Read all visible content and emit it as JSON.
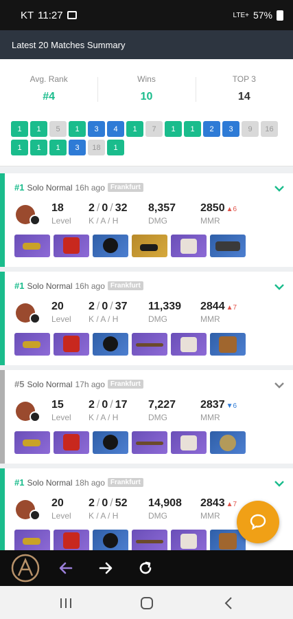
{
  "status_bar": {
    "carrier": "KT",
    "time": "11:27",
    "network": "LTE+",
    "battery": "57%"
  },
  "header": {
    "title": "Latest 20 Matches Summary"
  },
  "summary": {
    "stats": [
      {
        "label": "Avg. Rank",
        "value": "#4",
        "color": "#1abc8c"
      },
      {
        "label": "Wins",
        "value": "10",
        "color": "#1abc8c"
      },
      {
        "label": "TOP 3",
        "value": "14",
        "color": "#333333"
      }
    ],
    "ranks_row1": [
      {
        "v": "1",
        "c": "green"
      },
      {
        "v": "1",
        "c": "green"
      },
      {
        "v": "5",
        "c": "gray"
      },
      {
        "v": "1",
        "c": "green"
      },
      {
        "v": "3",
        "c": "blue"
      },
      {
        "v": "4",
        "c": "blue"
      },
      {
        "v": "1",
        "c": "green"
      },
      {
        "v": "7",
        "c": "gray"
      },
      {
        "v": "1",
        "c": "green"
      },
      {
        "v": "1",
        "c": "green"
      },
      {
        "v": "2",
        "c": "blue"
      },
      {
        "v": "3",
        "c": "blue"
      },
      {
        "v": "9",
        "c": "gray"
      },
      {
        "v": "16",
        "c": "gray"
      }
    ],
    "ranks_row2": [
      {
        "v": "1",
        "c": "green"
      },
      {
        "v": "1",
        "c": "green"
      },
      {
        "v": "1",
        "c": "green"
      },
      {
        "v": "3",
        "c": "blue"
      },
      {
        "v": "18",
        "c": "gray"
      },
      {
        "v": "1",
        "c": "green"
      }
    ]
  },
  "rank_colors": {
    "green": "#1abc8c",
    "blue": "#2e7bd6",
    "gray": "#d9d9d9"
  },
  "stat_labels": {
    "level": "Level",
    "kah": "K / A / H",
    "dmg": "DMG",
    "mmr": "MMR"
  },
  "matches": [
    {
      "place": "#1",
      "mode": "Solo Normal",
      "ago": "16h ago",
      "server": "Frankfurt",
      "level": "18",
      "k": "2",
      "a": "0",
      "h": "32",
      "dmg": "8,357",
      "mmr": "2850",
      "delta_sign": "▲",
      "delta": "6",
      "win": true,
      "chevron": "green",
      "items": [
        "gun-icon",
        "shirt-icon",
        "helmet-icon",
        "glove-icon",
        "boots-icon",
        "tape-icon"
      ]
    },
    {
      "place": "#1",
      "mode": "Solo Normal",
      "ago": "16h ago",
      "server": "Frankfurt",
      "level": "20",
      "k": "2",
      "a": "0",
      "h": "37",
      "dmg": "11,339",
      "mmr": "2844",
      "delta_sign": "▲",
      "delta": "7",
      "win": true,
      "chevron": "green",
      "items": [
        "gun-icon",
        "shirt-icon",
        "helmet-icon",
        "stick-icon",
        "boots-icon",
        "box-icon"
      ]
    },
    {
      "place": "#5",
      "mode": "Solo Normal",
      "ago": "17h ago",
      "server": "Frankfurt",
      "level": "15",
      "k": "2",
      "a": "0",
      "h": "17",
      "dmg": "7,227",
      "mmr": "2837",
      "delta_sign": "▼",
      "delta": "6",
      "win": false,
      "chevron": "gray",
      "items": [
        "gun-icon",
        "shirt-icon",
        "helmet-icon",
        "stick-icon",
        "boots-icon",
        "disc-icon"
      ]
    },
    {
      "place": "#1",
      "mode": "Solo Normal",
      "ago": "18h ago",
      "server": "Frankfurt",
      "level": "20",
      "k": "2",
      "a": "0",
      "h": "52",
      "dmg": "14,908",
      "mmr": "2843",
      "delta_sign": "▲",
      "delta": "7",
      "win": true,
      "chevron": "green",
      "items": [
        "gun-icon",
        "shirt-icon",
        "helmet-icon",
        "stick-icon",
        "boots-icon",
        "box-icon"
      ]
    }
  ],
  "toolbar": {
    "logo": "app-logo-icon",
    "back": "arrow-left-icon",
    "forward": "arrow-right-icon",
    "reload": "reload-icon"
  }
}
